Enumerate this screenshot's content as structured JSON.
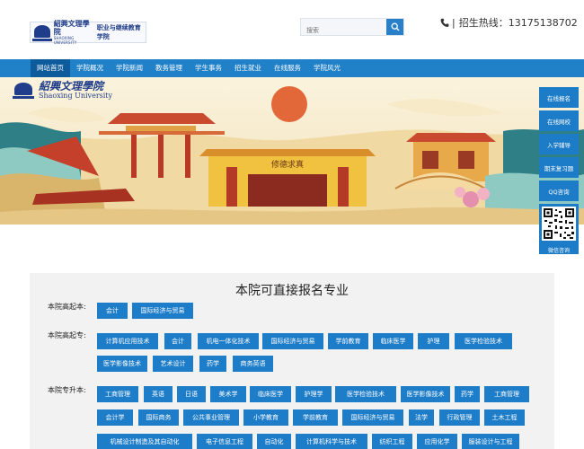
{
  "header": {
    "logo_cn": "紹興文理學院",
    "logo_en": "SHAOXING UNIVERSITY",
    "logo_sub": "职业与继续教育学院",
    "search_placeholder": "搜索",
    "hotline_icon": "phone-icon",
    "hotline_text": "招生热线：13175138702"
  },
  "nav": {
    "items": [
      "网站首页",
      "学院概况",
      "学院新闻",
      "教务管理",
      "学生事务",
      "招生就业",
      "在线服务",
      "学院风光"
    ]
  },
  "banner": {
    "logo_cn": "紹興文理學院",
    "logo_en": "Shaoxing University",
    "gate_text": "修德求真"
  },
  "side_menu": {
    "items": [
      "在线报名",
      "在线网校",
      "入学辅导",
      "期末复习题",
      "QQ咨询"
    ],
    "qr_label": "微信咨询"
  },
  "main": {
    "title": "本院可直接报名专业",
    "sections": [
      {
        "label": "本院高起本:",
        "rows": [
          [
            "会计",
            "国际经济与贸易"
          ]
        ]
      },
      {
        "label": "本院高起专:",
        "rows": [
          [
            "计算机应用技术",
            "会计",
            "机电一体化技术",
            "国际经济与贸易",
            "学前教育",
            "临床医学",
            "护理",
            "医学检验技术"
          ],
          [
            "医学影像技术",
            "艺术设计",
            "药学",
            "商务英语"
          ]
        ]
      },
      {
        "label": "本院专升本:",
        "rows": [
          [
            "工商管理",
            "英语",
            "日语",
            "美术学",
            "临床医学",
            "护理学",
            "医学检验技术",
            "医学影像技术",
            "药学",
            "工商管理"
          ],
          [
            "会计学",
            "国际商务",
            "公共事业管理",
            "小学教育",
            "学前教育",
            "国际经济与贸易",
            "法学",
            "行政管理",
            "土木工程"
          ],
          [
            "机械设计制造及其自动化",
            "电子信息工程",
            "自动化",
            "计算机科学与技术",
            "纺织工程",
            "应用化学",
            "服装设计与工程"
          ]
        ]
      }
    ]
  },
  "colors": {
    "nav_bg": "#2080c8",
    "nav_active": "#0e5b9c",
    "tag_bg": "#1e7dc9",
    "side_bg": "#1c7cc7",
    "content_bg": "#f2f2f2"
  }
}
